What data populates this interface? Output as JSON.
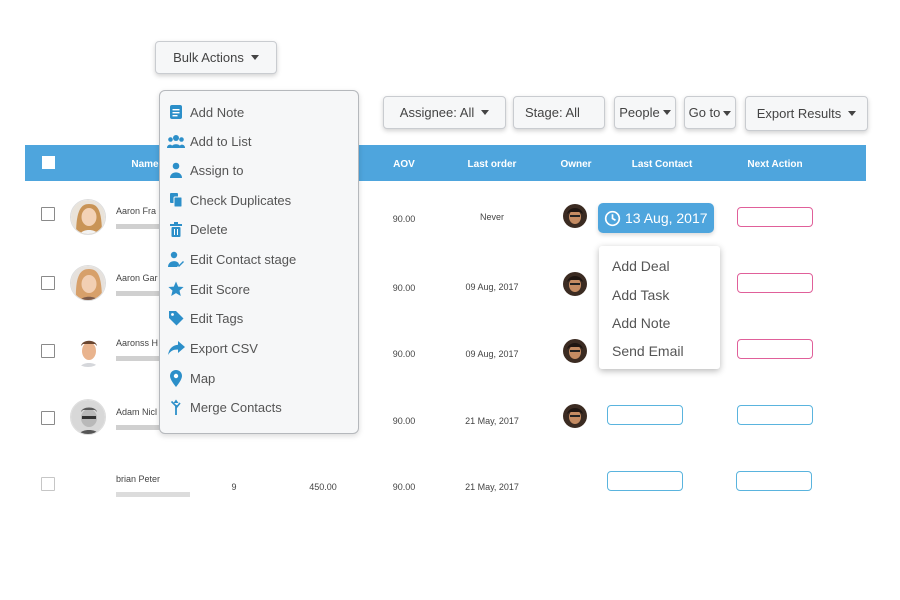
{
  "toolbar": {
    "bulk_actions": "Bulk Actions",
    "assignee": "Assignee: All",
    "stage": "Stage: All",
    "people": "People",
    "goto": "Go to",
    "export": "Export Results"
  },
  "table": {
    "columns": [
      "Name",
      "AOV",
      "Last order",
      "Owner",
      "Last Contact",
      "Next Action"
    ],
    "rows": [
      {
        "name": "Aaron Fra",
        "col3": "",
        "col4": "",
        "aov": "90.00",
        "last_order": "Never"
      },
      {
        "name": "Aaron Gar",
        "col3": "",
        "col4": "",
        "aov": "90.00",
        "last_order": "09 Aug, 2017"
      },
      {
        "name": "Aaronss H",
        "col3": "",
        "col4": "",
        "aov": "90.00",
        "last_order": "09 Aug, 2017"
      },
      {
        "name": "Adam Nicl",
        "col3": "",
        "col4": "",
        "aov": "90.00",
        "last_order": "21 May, 2017"
      },
      {
        "name": "brian Peter",
        "col3": "9",
        "col4": "450.00",
        "aov": "90.00",
        "last_order": "21 May, 2017"
      }
    ]
  },
  "last_contact_badge": "13 Aug, 2017",
  "bulk_menu": {
    "items": [
      "Add Note",
      "Add to List",
      "Assign to",
      "Check Duplicates",
      "Delete",
      "Edit Contact stage",
      "Edit Score",
      "Edit Tags",
      "Export CSV",
      "Map",
      "Merge Contacts"
    ],
    "icons": [
      "note-icon",
      "users-icon",
      "user-icon",
      "copy-icon",
      "trash-icon",
      "user-edit-icon",
      "star-icon",
      "tag-icon",
      "share-icon",
      "map-pin-icon",
      "merge-icon"
    ]
  },
  "action_menu": {
    "items": [
      "Add Deal",
      "Add Task",
      "Add Note",
      "Send Email"
    ]
  },
  "colors": {
    "header_bg": "#4ea5dd",
    "icon_blue": "#2c8fc9",
    "pink_outline": "#e0609a",
    "blue_outline": "#5ab4de"
  }
}
